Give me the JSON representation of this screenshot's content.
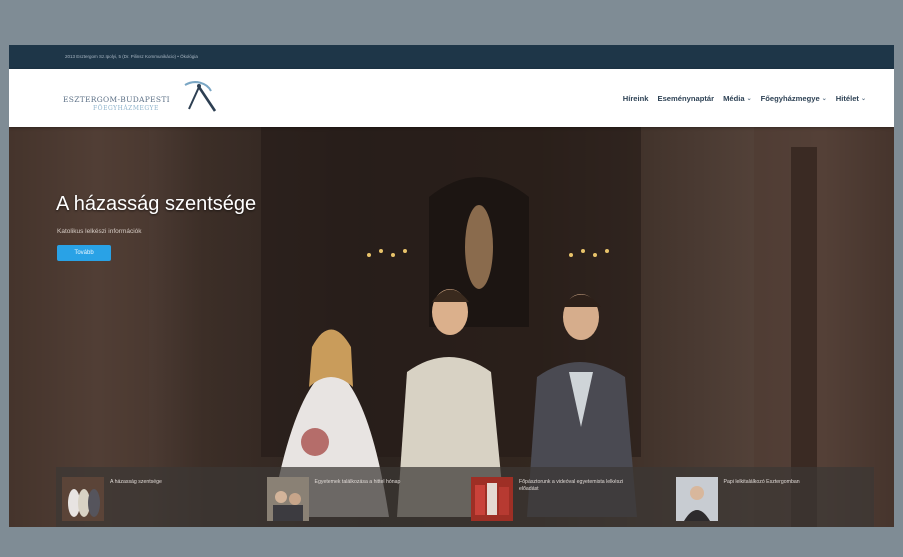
{
  "topbar": {
    "text": "2013 Esztergom Sz.Ipolyi, 5 (Dr. Pilinsz Kommunikácio) • Ökológia"
  },
  "logo": {
    "line1": "ESZTERGOM-BUDAPESTI",
    "line2": "FŐEGYHÁZMEGYE"
  },
  "nav": {
    "items": [
      {
        "label": "Híreink",
        "has_dropdown": false
      },
      {
        "label": "Eseménynaptár",
        "has_dropdown": false
      },
      {
        "label": "Média",
        "has_dropdown": true
      },
      {
        "label": "Főegyházmegye",
        "has_dropdown": true
      },
      {
        "label": "Hitélet",
        "has_dropdown": true
      }
    ],
    "chevron_icon": "chevron-down-icon"
  },
  "hero": {
    "title": "A házasság szentsége",
    "subtitle": "Katolikus lelkészi információk",
    "button_label": "Tovább"
  },
  "strip": {
    "items": [
      {
        "text": "A házasság szentsége"
      },
      {
        "text": "Egyetemek találkozása a hittel hónap"
      },
      {
        "text": "Főpásztorunk a videóval egyetemista lelkészi előadást"
      },
      {
        "text": "Papi lelkitalálkozó Esztergomban"
      }
    ]
  },
  "colors": {
    "topbar": "#1e3648",
    "accent": "#29a2e6",
    "nav_text": "#2f4356",
    "page_bg": "#7f8c95"
  }
}
